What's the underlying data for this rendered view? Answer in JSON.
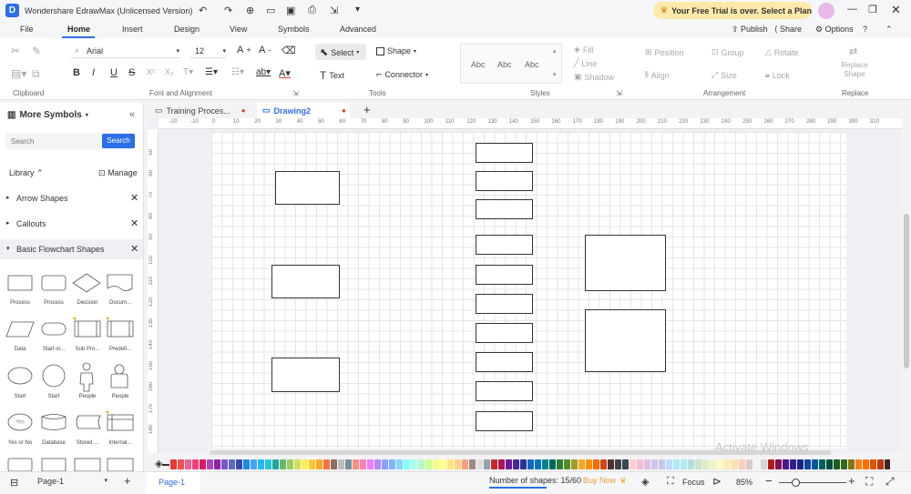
{
  "app": {
    "title": "Wondershare EdrawMax (Unlicensed Version)",
    "trial": "Your Free Trial is over. Select a Plan"
  },
  "menu": {
    "items": [
      "File",
      "Home",
      "Insert",
      "Design",
      "View",
      "Symbols",
      "Advanced"
    ],
    "publish": "Publish",
    "share": "Share",
    "options": "Options"
  },
  "ribbon": {
    "font": "Arial",
    "size": "12",
    "select": "Select",
    "shape": "Shape",
    "text": "Text",
    "connector": "Connector",
    "style_samples": [
      "Abc",
      "Abc",
      "Abc"
    ],
    "fill": "Fill",
    "line": "Line",
    "shadow": "Shadow",
    "position": "Position",
    "group": "Group",
    "rotate": "Rotate",
    "align": "Align",
    "size_l": "Size",
    "lock": "Lock",
    "replace_shape": "Replace Shape",
    "groups": {
      "clipboard": "Clipboard",
      "font": "Font and Alignment",
      "tools": "Tools",
      "styles": "Styles",
      "arrangement": "Arrangement",
      "replace": "Replace"
    }
  },
  "sidebar": {
    "title": "More Symbols",
    "search_placeholder": "Search",
    "search_btn": "Search",
    "library": "Library",
    "manage": "Manage",
    "categories": [
      "Arrow Shapes",
      "Callouts",
      "Basic Flowchart Shapes"
    ],
    "shapes": [
      "Process",
      "Process",
      "Decision",
      "Docum...",
      "Data",
      "Start or...",
      "Sub Pro...",
      "Predefi...",
      "Start",
      "Start",
      "People",
      "People",
      "Yes or No",
      "Database",
      "Stored ...",
      "Internal..."
    ]
  },
  "tabs": [
    "Training Proces...",
    "Drawing2"
  ],
  "ruler_h": [
    "-20",
    "-10",
    "0",
    "10",
    "20",
    "30",
    "40",
    "50",
    "60",
    "70",
    "80",
    "90",
    "100",
    "110",
    "120",
    "130",
    "140",
    "150",
    "160",
    "170",
    "180",
    "190",
    "200",
    "210",
    "220",
    "230",
    "240",
    "250",
    "260",
    "270",
    "280",
    "290",
    "300",
    "310"
  ],
  "ruler_v": [
    "50",
    "60",
    "70",
    "80",
    "90",
    "100",
    "110",
    "120",
    "130",
    "140",
    "150",
    "160",
    "170",
    "180"
  ],
  "watermark": "Activate Windows",
  "status": {
    "page_sel": "Page-1",
    "page_tab": "Page-1",
    "shapes": "Number of shapes: 15/60",
    "buy": "Buy Now",
    "focus": "Focus",
    "zoom": "85%"
  },
  "colors": [
    "#e53935",
    "#ef5350",
    "#f06292",
    "#ec407a",
    "#d81b60",
    "#ab47bc",
    "#8e24aa",
    "#7e57c2",
    "#5c6bc0",
    "#3949ab",
    "#1e88e5",
    "#42a5f5",
    "#29b6f6",
    "#26c6da",
    "#26a69a",
    "#66bb6a",
    "#9ccc65",
    "#d4e157",
    "#ffee58",
    "#ffca28",
    "#ffa726",
    "#ff7043",
    "#8d6e63",
    "#bdbdbd",
    "#78909c",
    "#ff8a80",
    "#ff80ab",
    "#ea80fc",
    "#b388ff",
    "#8c9eff",
    "#82b1ff",
    "#80d8ff",
    "#84ffff",
    "#a7ffeb",
    "#b9f6ca",
    "#ccff90",
    "#f4ff81",
    "#ffff8d",
    "#ffe57f",
    "#ffd180",
    "#ff9e80",
    "#a1887f",
    "#e0e0e0",
    "#90a4ae",
    "#c62828",
    "#ad1457",
    "#6a1b9a",
    "#4527a0",
    "#283593",
    "#1565c0",
    "#0277bd",
    "#00838f",
    "#00695c",
    "#2e7d32",
    "#558b2f",
    "#9e9d24",
    "#f9a825",
    "#ff8f00",
    "#ef6c00",
    "#d84315",
    "#4e342e",
    "#424242",
    "#37474f",
    "#ffcdd2",
    "#f8bbd0",
    "#e1bee7",
    "#d1c4e9",
    "#c5cae9",
    "#bbdefb",
    "#b3e5fc",
    "#b2ebf2",
    "#b2dfdb",
    "#c8e6c9",
    "#dcedc8",
    "#f0f4c3",
    "#fff9c4",
    "#ffecb3",
    "#ffe0b2",
    "#ffccbc",
    "#d7ccc8",
    "#f5f5f5",
    "#cfd8dc",
    "#b71c1c",
    "#880e4f",
    "#4a148c",
    "#311b92",
    "#1a237e",
    "#0d47a1",
    "#01579b",
    "#006064",
    "#004d40",
    "#1b5e20",
    "#33691e",
    "#827717",
    "#f57f17",
    "#ff6f00",
    "#e65100",
    "#bf360c",
    "#3e2723",
    "#212121",
    "#263238",
    "#ffffff",
    "#000000",
    "#757575"
  ]
}
